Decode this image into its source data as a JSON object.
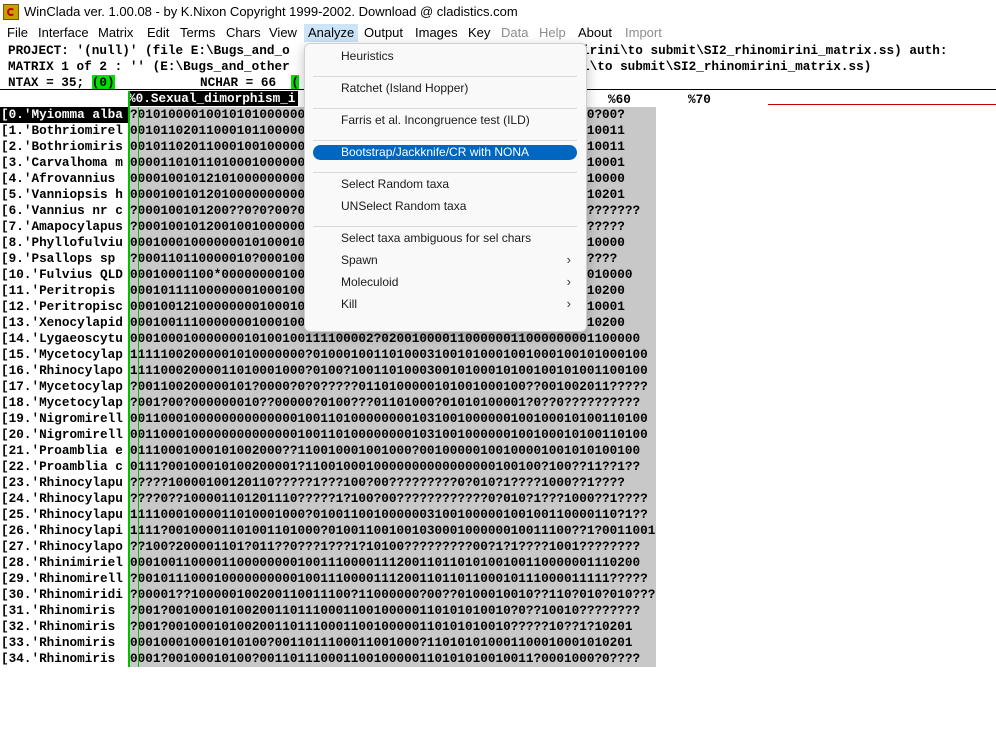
{
  "window": {
    "title": "WinClada ver. 1.00.08  - by K.Nixon Copyright 1999-2002. Download @ cladistics.com"
  },
  "menubar": [
    {
      "label": "File",
      "disabled": false
    },
    {
      "label": "Interface",
      "disabled": false
    },
    {
      "label": "Matrix",
      "disabled": false
    },
    {
      "label": "Edit",
      "disabled": false
    },
    {
      "label": "Terms",
      "disabled": false
    },
    {
      "label": "Chars",
      "disabled": false
    },
    {
      "label": "View",
      "disabled": false
    },
    {
      "label": "Analyze",
      "disabled": false,
      "active": true
    },
    {
      "label": "Output",
      "disabled": false
    },
    {
      "label": "Images",
      "disabled": false
    },
    {
      "label": "Key",
      "disabled": false
    },
    {
      "label": "Data",
      "disabled": true
    },
    {
      "label": "Help",
      "disabled": true
    },
    {
      "label": "About",
      "disabled": false
    },
    {
      "label": "Import",
      "disabled": true
    }
  ],
  "header": {
    "line1_left": "PROJECT: '(null)' (file E:\\Bugs_and_o",
    "line1_right": "irini\\to submit\\SI2_rhinomirini_matrix.ss) auth:",
    "line2_left": "MATRIX 1 of 2 : '' (E:\\Bugs_and_other",
    "line2_right": "i\\to submit\\SI2_rhinomirini_matrix.ss)",
    "ntax_label": "NTAX = 35;",
    "ntax_sel": "(0)",
    "nchar_label": "NCHAR = 66",
    "nchar_sel": "("
  },
  "column_ruler": {
    "selected_char": "%0.Sexual_dimorphism_i",
    "marks": [
      "%60",
      "%70"
    ]
  },
  "taxa": [
    {
      "name": "[0.'Myiomma alba",
      "chars": "?0101000010010101000000001100000000000100110010000000100?00?0?00?"
    },
    {
      "name": "[1.'Bothriomirel",
      "chars": "00101102011000101100000000010011001000000001001100000000100?10011"
    },
    {
      "name": "[2.'Bothriomiris",
      "chars": "00101102011000100100000000010011001000000001001100000000100?10011"
    },
    {
      "name": "[3.'Carvalhoma m",
      "chars": "00001101011010001000000000010011001000000001001100000000000?10001"
    },
    {
      "name": "[4.'Afrovannius ",
      "chars": "00001001012101000000000000010011001000000001001100000000100?10000"
    },
    {
      "name": "[5.'Vanniopsis h",
      "chars": "00001001012010000000000000010011001000000001001100000000001110201"
    },
    {
      "name": "[6.'Vannius nr c",
      "chars": "?000100101200??0?0?00?0000010011001000000001001100?????????????????"
    },
    {
      "name": "[7.'Amapocylapus",
      "chars": "?00010010120010010000000000100110010000000010011000000000100?????"
    },
    {
      "name": "[8.'Phyllofulviu",
      "chars": "00010001000000010100010000010011001000000001001100000000100?10000"
    },
    {
      "name": "[9.'Psallops sp ",
      "chars": "?000110110000010?000100000010011001000000001001100000000?00?????"
    },
    {
      "name": "[10.'Fulvius QLD",
      "chars": "00010001100*000000001000000100110010000000010011000000000101010000"
    },
    {
      "name": "[11.'Peritropis ",
      "chars": "00010111100000001000100000010011001000000001001100000000001010200"
    },
    {
      "name": "[12.'Peritropisc",
      "chars": "00010012100000000100010000010011001000000001001100000000001010001"
    },
    {
      "name": "[13.'Xenocylapid",
      "chars": "00010011100000001000100000010011001000000001001100000000001110200"
    },
    {
      "name": "[14.'Lygaeoscytu",
      "chars": "00010001000000010100100111100002?0200100001100000011000000001100000"
    },
    {
      "name": "[15.'Mycetocylap",
      "chars": "11111002000001010000000?01000100110100031001010001001000100101000100"
    },
    {
      "name": "[16.'Rhinocylapo",
      "chars": "11110002000011010001000?0100?100110100030010100010100100101001100100"
    },
    {
      "name": "[17.'Mycetocylap",
      "chars": "?001100200000101?0000?0?0?????0110100000101001000100??001002011?????"
    },
    {
      "name": "[18.'Mycetocylap",
      "chars": "?001?00?000000010??00000?0100???01101000?01010100001?0??0??????????"
    },
    {
      "name": "[19.'Nigromirell",
      "chars": "00110001000000000000001001101000000001031001000000100100010100110100"
    },
    {
      "name": "[20.'Nigromirell",
      "chars": "00110001000000000000001001101000000001031001000000100100010100110100"
    },
    {
      "name": "[21.'Proamblia e",
      "chars": "01110001000101002000??110010001001000?00100000100100001001010100100"
    },
    {
      "name": "[22.'Proamblia c",
      "chars": "0111?00100010100200001?1100100010000000000000000100100?100??11??1??"
    },
    {
      "name": "[23.'Rhinocylapu",
      "chars": "?????10000100120110?????1???100?00?????????0?010?1????1000??1????"
    },
    {
      "name": "[24.'Rhinocylapu",
      "chars": "????0??100001101201110?????1?100?00????????????0?010?1???1000??1????"
    },
    {
      "name": "[25.'Rhinocylapu",
      "chars": "11110001000011010001000?0100110010000003100100000100100110000110?1??"
    },
    {
      "name": "[26.'Rhinocylapi",
      "chars": "1111?00100001101001101000?01001100100103000100000010011100??1?001100100"
    },
    {
      "name": "[27.'Rhinocylapo",
      "chars": "??100?200001101?011??0???1???1?10100?????????00?1?1????1001????????"
    },
    {
      "name": "[28.'Rhinimiriel",
      "chars": "0001001100001100000000100111000011120011011010100100110000001110200"
    },
    {
      "name": "[29.'Rhinomirell",
      "chars": "?00101110001000000000010011100001112001101101100010111000011111?????"
    },
    {
      "name": "[30.'Rhinomiridi",
      "chars": "?00001??100000100200110011100?11000000?00??0100010010??110?010?010??????"
    },
    {
      "name": "[31.'Rhinomiris ",
      "chars": "?001?001000101002001101110001100100000110101010010?0??10010????????"
    },
    {
      "name": "[32.'Rhinomiris ",
      "chars": "?001?001000101002001101110001100100000110101010010?????10??1?10201"
    },
    {
      "name": "[33.'Rhinomiris ",
      "chars": "000100010001010100?0011011100011001000?110101010001100010001010201"
    },
    {
      "name": "[34.'Rhinomiris ",
      "chars": "0001?00100010100?001101110001100100000110101010010011?0001000?0????"
    }
  ],
  "dropdown": {
    "items": [
      {
        "label": "Heuristics"
      },
      {
        "sep": true
      },
      {
        "label": "Ratchet (Island Hopper)"
      },
      {
        "sep": true
      },
      {
        "label": "Farris et al. Incongruence test (ILD)"
      },
      {
        "sep": true
      },
      {
        "label": "Bootstrap/Jackknife/CR with NONA",
        "highlighted": true
      },
      {
        "sep": true
      },
      {
        "label": "Select Random taxa"
      },
      {
        "label": "UNSelect Random taxa"
      },
      {
        "sep": true
      },
      {
        "label": "Select taxa ambiguous for sel chars"
      },
      {
        "label": "Spawn",
        "submenu": true
      },
      {
        "label": "Moleculoid",
        "submenu": true
      },
      {
        "label": "Kill",
        "submenu": true
      }
    ]
  }
}
